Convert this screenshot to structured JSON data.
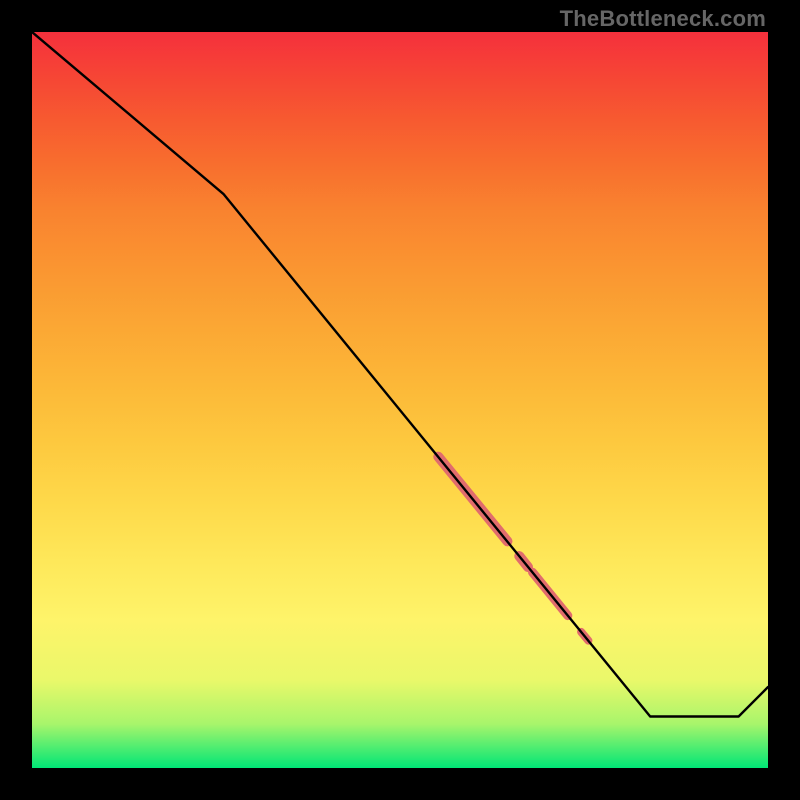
{
  "attribution": "TheBottleneck.com",
  "colors": {
    "bg": "#000000",
    "line": "#000000",
    "highlight": "#e16c6c",
    "gradient_top": "#f5303c",
    "gradient_mid": "#fed94a",
    "gradient_bottom": "#00e676"
  },
  "chart_data": {
    "type": "line",
    "title": "",
    "xlabel": "",
    "ylabel": "",
    "xlim": [
      0,
      100
    ],
    "ylim": [
      0,
      100
    ],
    "series": [
      {
        "name": "bottleneck-curve",
        "x": [
          0,
          26,
          84,
          96,
          100
        ],
        "y": [
          100,
          78,
          7,
          7,
          11
        ]
      }
    ],
    "highlight_segments": [
      {
        "name": "thick-upper",
        "x0": 55.2,
        "y0": 42.3,
        "x1": 64.6,
        "y1": 30.8,
        "width": 10
      },
      {
        "name": "dot-1",
        "x0": 66.2,
        "y0": 28.8,
        "x1": 67.4,
        "y1": 27.3,
        "width": 10
      },
      {
        "name": "mid-segment",
        "x0": 68.0,
        "y0": 26.6,
        "x1": 72.8,
        "y1": 20.7,
        "width": 9
      },
      {
        "name": "dot-2",
        "x0": 74.6,
        "y0": 18.5,
        "x1": 75.6,
        "y1": 17.3,
        "width": 8
      }
    ]
  }
}
